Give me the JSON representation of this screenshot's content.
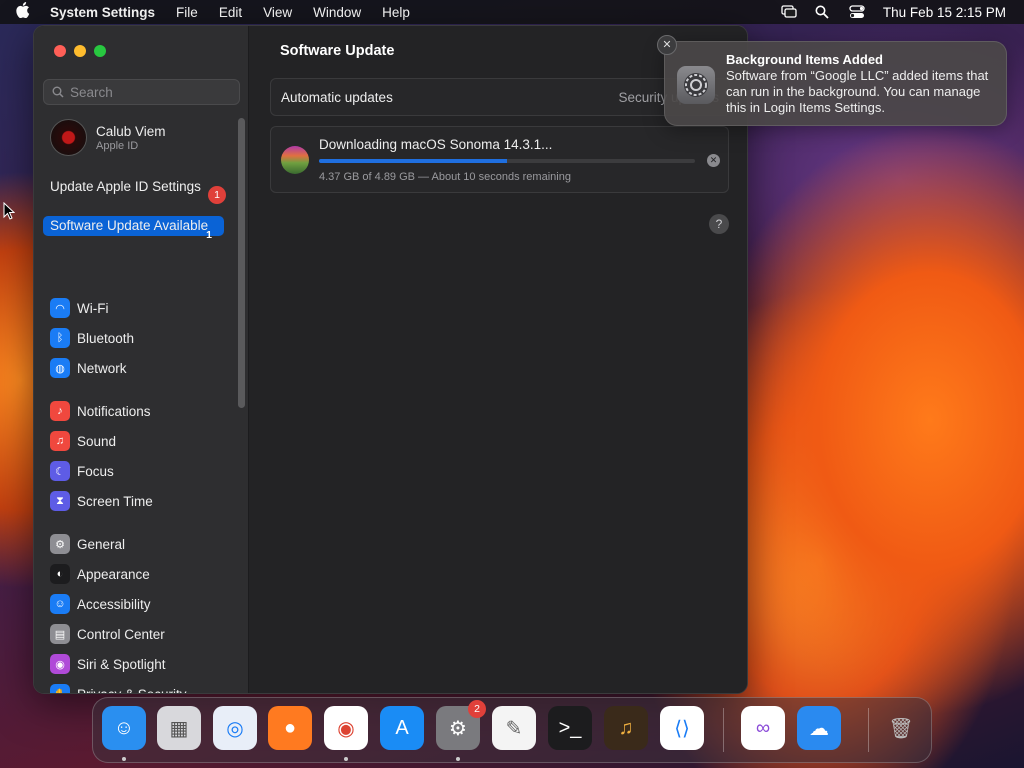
{
  "menubar": {
    "app": "System Settings",
    "menus": [
      "File",
      "Edit",
      "View",
      "Window",
      "Help"
    ],
    "clock": "Thu Feb 15  2:15 PM"
  },
  "sidebar": {
    "search_placeholder": "Search",
    "account": {
      "name": "Calub Viem",
      "sub": "Apple ID"
    },
    "notices": [
      {
        "label": "Update Apple ID Settings",
        "badge": "1"
      },
      {
        "label": "Software Update Available",
        "badge": "1"
      }
    ],
    "groups": [
      [
        {
          "label": "Wi-Fi",
          "icon": "wifi-icon",
          "color": "#1a7cf5"
        },
        {
          "label": "Bluetooth",
          "icon": "bluetooth-icon",
          "color": "#1a7cf5"
        },
        {
          "label": "Network",
          "icon": "globe-icon",
          "color": "#1a7cf5"
        }
      ],
      [
        {
          "label": "Notifications",
          "icon": "bell-icon",
          "color": "#f0483e"
        },
        {
          "label": "Sound",
          "icon": "speaker-icon",
          "color": "#f0483e"
        },
        {
          "label": "Focus",
          "icon": "moon-icon",
          "color": "#5e5ce6"
        },
        {
          "label": "Screen Time",
          "icon": "hourglass-icon",
          "color": "#5e5ce6"
        }
      ],
      [
        {
          "label": "General",
          "icon": "gear-icon",
          "color": "#8e8e93"
        },
        {
          "label": "Appearance",
          "icon": "appearance-icon",
          "color": "#1c1c1e"
        },
        {
          "label": "Accessibility",
          "icon": "accessibility-icon",
          "color": "#1a7cf5"
        },
        {
          "label": "Control Center",
          "icon": "control-center-icon",
          "color": "#8e8e93"
        },
        {
          "label": "Siri & Spotlight",
          "icon": "siri-icon",
          "color": "#b04ad8"
        },
        {
          "label": "Privacy & Security",
          "icon": "hand-icon",
          "color": "#1a7cf5"
        }
      ]
    ]
  },
  "main": {
    "title": "Software Update",
    "automatic_updates": {
      "label": "Automatic updates",
      "value": "Security updates"
    },
    "download": {
      "title": "Downloading macOS Sonoma 14.3.1...",
      "progress": 0.5,
      "status": "4.37 GB of 4.89 GB — About 10 seconds remaining"
    },
    "help": "?"
  },
  "notification": {
    "title": "Background Items Added",
    "body": "Software from “Google LLC” added items that can run in the background. You can manage this in Login Items Settings."
  },
  "dock": {
    "apps": [
      {
        "name": "Finder",
        "icon": "finder-icon",
        "color": "#2a8ff0",
        "running": true
      },
      {
        "name": "Launchpad",
        "icon": "launchpad-icon",
        "color": "#d8d8dc",
        "running": false
      },
      {
        "name": "Safari",
        "icon": "safari-icon",
        "color": "#e8eef8",
        "running": false
      },
      {
        "name": "Firefox",
        "icon": "firefox-icon",
        "color": "#ff7a20",
        "running": false
      },
      {
        "name": "Chrome",
        "icon": "chrome-icon",
        "color": "#ffffff",
        "running": true
      },
      {
        "name": "App Store",
        "icon": "app-store-icon",
        "color": "#1a8cf5",
        "running": false
      },
      {
        "name": "System Settings",
        "icon": "settings-icon",
        "color": "#7a7a7e",
        "running": true,
        "badge": "2"
      },
      {
        "name": "TextEdit",
        "icon": "textedit-icon",
        "color": "#f4f4f4",
        "running": false
      },
      {
        "name": "Terminal",
        "icon": "terminal-icon",
        "color": "#1c1c1e",
        "running": false
      },
      {
        "name": "GarageBand",
        "icon": "garageband-icon",
        "color": "#3a2a1a",
        "running": false
      },
      {
        "name": "Visual Studio Code",
        "icon": "vscode-icon",
        "color": "#ffffff",
        "running": false
      },
      {
        "name": "Visual Studio",
        "icon": "visual-studio-icon",
        "color": "#ffffff",
        "running": false
      },
      {
        "name": "Weather",
        "icon": "weather-icon",
        "color": "#2a8af0",
        "running": false
      },
      {
        "name": "Trash",
        "icon": "trash-icon",
        "color": "transparent",
        "running": false
      }
    ]
  }
}
